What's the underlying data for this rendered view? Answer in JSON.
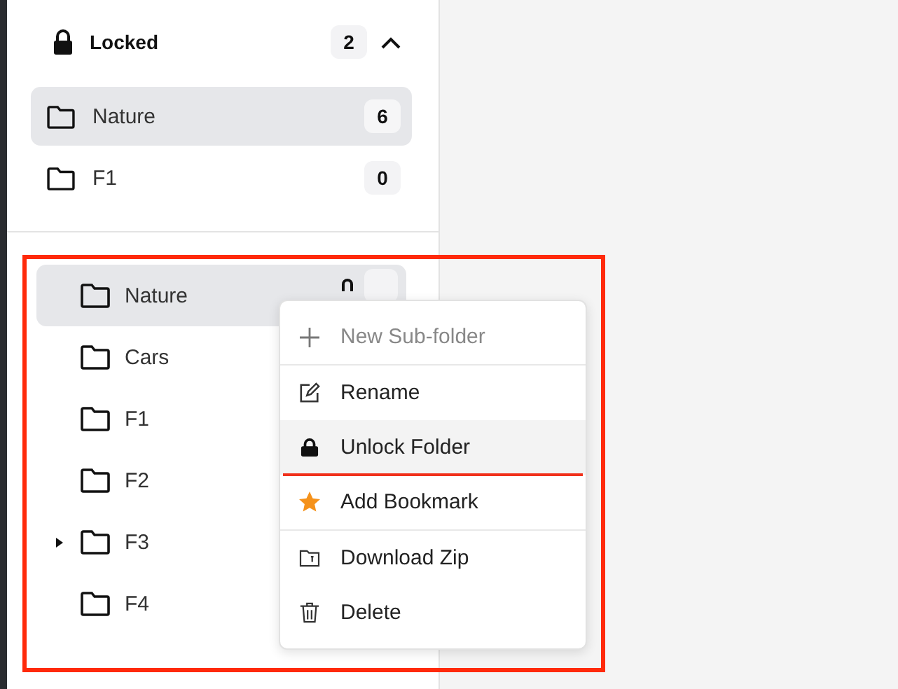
{
  "locked_section": {
    "title": "Locked",
    "count": "2",
    "expanded": true,
    "folders": [
      {
        "name": "Nature",
        "count": "6",
        "selected": true
      },
      {
        "name": "F1",
        "count": "0",
        "selected": false
      }
    ]
  },
  "folder_tree": [
    {
      "name": "Nature",
      "selected": true,
      "locked": true,
      "has_children": false
    },
    {
      "name": "Cars",
      "selected": false,
      "locked": false,
      "has_children": false
    },
    {
      "name": "F1",
      "selected": false,
      "locked": false,
      "has_children": false
    },
    {
      "name": "F2",
      "selected": false,
      "locked": false,
      "has_children": false
    },
    {
      "name": "F3",
      "selected": false,
      "locked": false,
      "has_children": true
    },
    {
      "name": "F4",
      "selected": false,
      "locked": false,
      "has_children": false
    }
  ],
  "context_menu": {
    "items": [
      {
        "kind": "add",
        "label": "New Sub-folder",
        "disabled": true,
        "hovered": false,
        "divider_after": true
      },
      {
        "kind": "rename",
        "label": "Rename",
        "disabled": false,
        "hovered": false,
        "divider_after": false
      },
      {
        "kind": "lock",
        "label": "Unlock Folder",
        "disabled": false,
        "hovered": true,
        "divider_after": false
      },
      {
        "kind": "bookmark",
        "label": "Add Bookmark",
        "disabled": false,
        "hovered": false,
        "divider_after": true
      },
      {
        "kind": "download",
        "label": "Download Zip",
        "disabled": false,
        "hovered": false,
        "divider_after": false
      },
      {
        "kind": "delete",
        "label": "Delete",
        "disabled": false,
        "hovered": false,
        "divider_after": false
      }
    ]
  }
}
